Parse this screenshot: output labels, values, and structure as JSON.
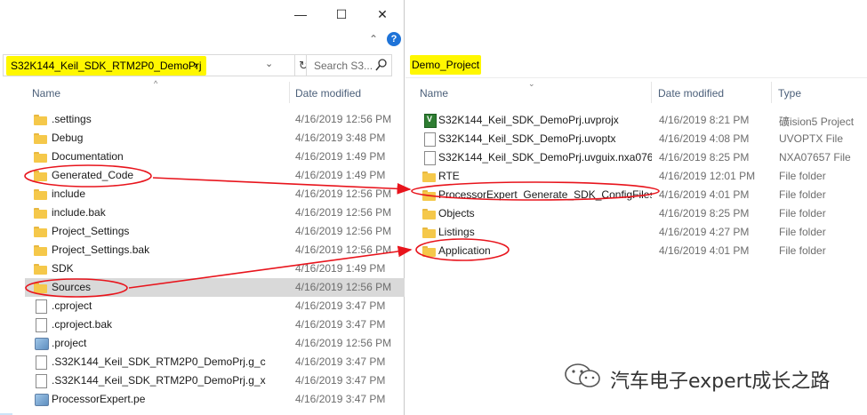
{
  "left_window": {
    "caption_buttons": {
      "minimize": "—",
      "maximize": "☐",
      "close": "✕"
    },
    "help": "?",
    "ribbon_expand": "⌃",
    "address": {
      "path": "S32K144_Keil_SDK_RTM2P0_DemoPrj",
      "chevron": "›",
      "dropdown": "⌄",
      "refresh": "↻"
    },
    "search": {
      "placeholder": "Search S3..."
    },
    "columns": {
      "name": "Name",
      "date": "Date modified",
      "sort_caret": "^"
    },
    "items": [
      {
        "name": ".settings",
        "date": "4/16/2019 12:56 PM",
        "icon": "folder-icon"
      },
      {
        "name": "Debug",
        "date": "4/16/2019 3:48 PM",
        "icon": "folder-icon"
      },
      {
        "name": "Documentation",
        "date": "4/16/2019 1:49 PM",
        "icon": "folder-icon"
      },
      {
        "name": "Generated_Code",
        "date": "4/16/2019 1:49 PM",
        "icon": "folder-icon"
      },
      {
        "name": "include",
        "date": "4/16/2019 12:56 PM",
        "icon": "folder-icon"
      },
      {
        "name": "include.bak",
        "date": "4/16/2019 12:56 PM",
        "icon": "folder-icon"
      },
      {
        "name": "Project_Settings",
        "date": "4/16/2019 12:56 PM",
        "icon": "folder-icon"
      },
      {
        "name": "Project_Settings.bak",
        "date": "4/16/2019 12:56 PM",
        "icon": "folder-icon"
      },
      {
        "name": "SDK",
        "date": "4/16/2019 1:49 PM",
        "icon": "folder-icon"
      },
      {
        "name": "Sources",
        "date": "4/16/2019 12:56 PM",
        "icon": "folder-icon",
        "selected": true
      },
      {
        "name": ".cproject",
        "date": "4/16/2019 3:47 PM",
        "icon": "document-icon"
      },
      {
        "name": ".cproject.bak",
        "date": "4/16/2019 3:47 PM",
        "icon": "document-icon"
      },
      {
        "name": ".project",
        "date": "4/16/2019 12:56 PM",
        "icon": "eclipse-project-icon"
      },
      {
        "name": ".S32K144_Keil_SDK_RTM2P0_DemoPrj.g_c",
        "date": "4/16/2019 3:47 PM",
        "icon": "document-icon"
      },
      {
        "name": ".S32K144_Keil_SDK_RTM2P0_DemoPrj.g_x",
        "date": "4/16/2019 3:47 PM",
        "icon": "document-icon"
      },
      {
        "name": "ProcessorExpert.pe",
        "date": "4/16/2019 3:47 PM",
        "icon": "eclipse-project-icon"
      }
    ]
  },
  "right_window": {
    "address": {
      "path": "Demo_Project"
    },
    "columns": {
      "name": "Name",
      "date": "Date modified",
      "type": "Type",
      "sort_caret": "⌄"
    },
    "items": [
      {
        "name": "S32K144_Keil_SDK_DemoPrj.uvprojx",
        "date": "4/16/2019 8:21 PM",
        "type": "礦ision5 Project",
        "icon": "uvision-project-icon"
      },
      {
        "name": "S32K144_Keil_SDK_DemoPrj.uvoptx",
        "date": "4/16/2019 4:08 PM",
        "type": "UVOPTX File",
        "icon": "document-icon"
      },
      {
        "name": "S32K144_Keil_SDK_DemoPrj.uvguix.nxa076...",
        "date": "4/16/2019 8:25 PM",
        "type": "NXA07657 File",
        "icon": "document-icon"
      },
      {
        "name": "RTE",
        "date": "4/16/2019 12:01 PM",
        "type": "File folder",
        "icon": "folder-icon"
      },
      {
        "name": "ProcessorExpert_Generate_SDK_ConfigFiles",
        "date": "4/16/2019 4:01 PM",
        "type": "File folder",
        "icon": "folder-icon"
      },
      {
        "name": "Objects",
        "date": "4/16/2019 8:25 PM",
        "type": "File folder",
        "icon": "folder-icon"
      },
      {
        "name": "Listings",
        "date": "4/16/2019 4:27 PM",
        "type": "File folder",
        "icon": "folder-icon"
      },
      {
        "name": "Application",
        "date": "4/16/2019 4:01 PM",
        "type": "File folder",
        "icon": "folder-icon"
      }
    ]
  },
  "annotations": {
    "highlight_color": "#fff700",
    "ink_color": "#e8141c"
  },
  "watermark": {
    "text": "汽车电子expert成长之路",
    "icon": "wechat-icon"
  }
}
